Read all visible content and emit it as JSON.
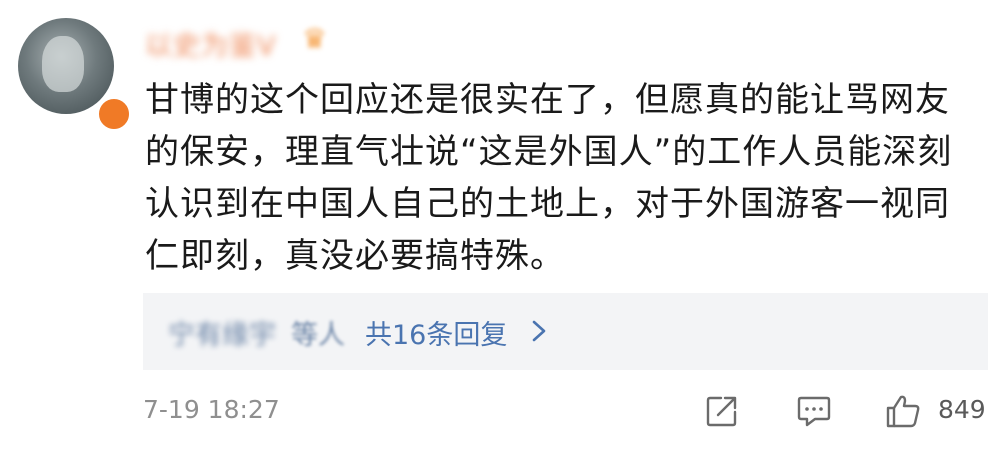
{
  "comment": {
    "username": "以史为鉴V",
    "text": "甘博的这个回应还是很实在了，但愿真的能让骂网友的保安，理直气壮说“这是外国人”的工作人员能深刻认识到在中国人自己的土地上，对于外国游客一视同仁即刻，真没必要搞特殊。",
    "timestamp": "7-19 18:27",
    "like_count": "849"
  },
  "replies": {
    "names": "宁有缘宇",
    "etc": "等人",
    "count_label": "共16条回复"
  },
  "colors": {
    "reply_link": "#4a74b0",
    "username": "#ef8a5a",
    "reply_bg": "#f3f4f6",
    "meta_text": "#8f8f8f"
  },
  "icons": {
    "share": "share-icon",
    "comment": "comment-icon",
    "like": "like-icon",
    "vip": "crown-icon"
  }
}
